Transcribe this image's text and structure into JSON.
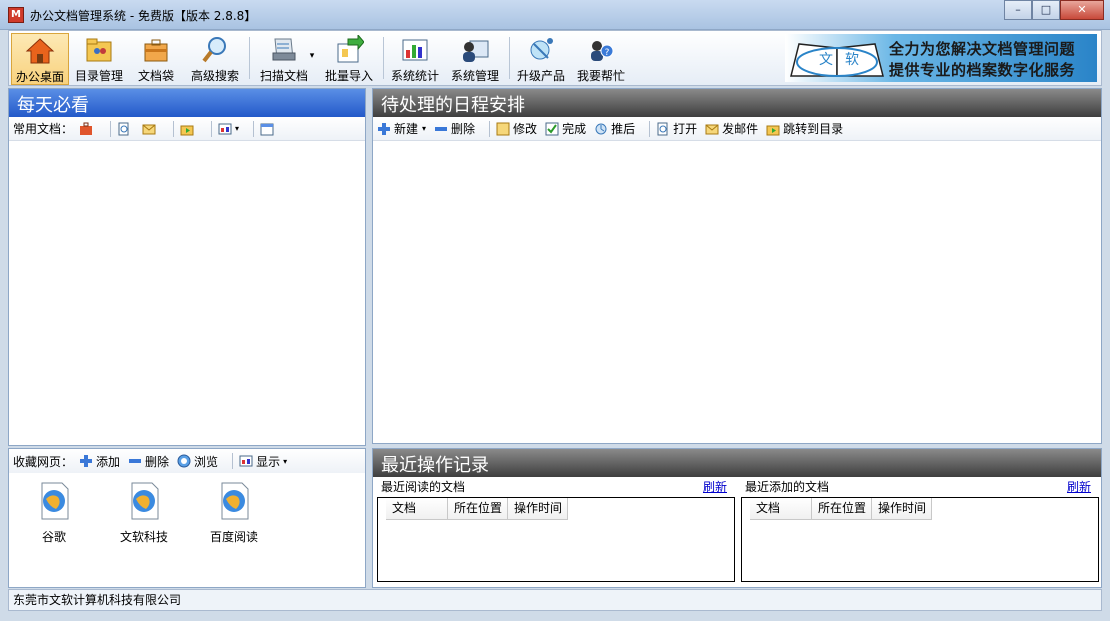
{
  "window": {
    "title": "办公文档管理系统  - 免费版【版本 2.8.8】",
    "icon_text": "M",
    "minimize_glyph": "–",
    "maximize_glyph": "□",
    "close_glyph": "✕"
  },
  "toolbar": {
    "items": [
      {
        "label": "办公桌面",
        "icon": "home-icon"
      },
      {
        "label": "目录管理",
        "icon": "folder-users-icon"
      },
      {
        "label": "文档袋",
        "icon": "briefcase-icon"
      },
      {
        "label": "高级搜索",
        "icon": "magnifier-icon"
      },
      {
        "label": "扫描文档",
        "icon": "scanner-icon"
      },
      {
        "label": "批量导入",
        "icon": "import-icon"
      },
      {
        "label": "系统统计",
        "icon": "chart-icon"
      },
      {
        "label": "系统管理",
        "icon": "admin-icon"
      },
      {
        "label": "升级产品",
        "icon": "satellite-icon"
      },
      {
        "label": "我要帮忙",
        "icon": "help-user-icon"
      }
    ],
    "banner": {
      "book_text_1": "文",
      "book_text_2": "软",
      "line1": "全力为您解决文档管理问题",
      "line2": "提供专业的档案数字化服务"
    }
  },
  "left_panel": {
    "title": "每天必看",
    "common_docs_label": "常用文档："
  },
  "favorites": {
    "label": "收藏网页：",
    "add": "添加",
    "delete": "删除",
    "browse": "浏览",
    "display": "显示",
    "items": [
      "谷歌",
      "文软科技",
      "百度阅读"
    ]
  },
  "schedule": {
    "title": "待处理的日程安排",
    "new": "新建",
    "delete": "删除",
    "edit": "修改",
    "done": "完成",
    "postpone": "推后",
    "open": "打开",
    "send_mail": "发邮件",
    "goto_dir": "跳转到目录"
  },
  "recent": {
    "title": "最近操作记录",
    "read": {
      "title": "最近阅读的文档",
      "refresh": "刷新",
      "columns": [
        "文档",
        "所在位置",
        "操作时间"
      ]
    },
    "added": {
      "title": "最近添加的文档",
      "refresh": "刷新",
      "columns": [
        "文档",
        "所在位置",
        "操作时间"
      ]
    }
  },
  "status": {
    "company": "东莞市文软计算机科技有限公司"
  },
  "colors": {
    "accent_blue": "#2359c9",
    "dark_header": "#3e3e3e",
    "link": "#0000cc"
  }
}
